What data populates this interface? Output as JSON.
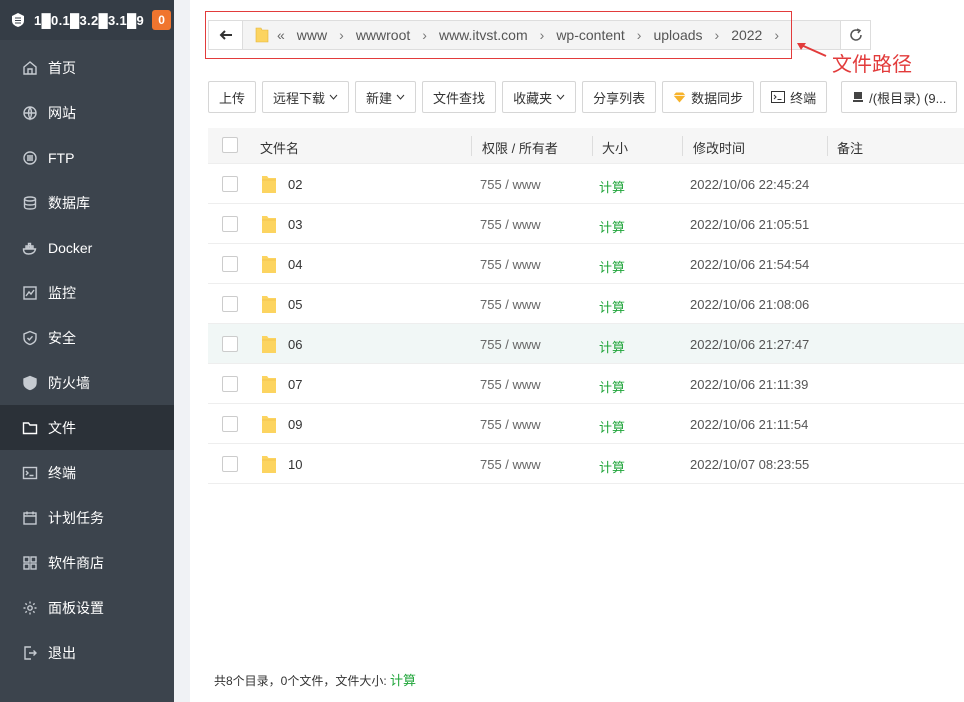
{
  "sidebar": {
    "server_ip": "1█0.1█3.2█3.1█9",
    "badge": "0",
    "items": [
      {
        "label": "首页",
        "icon": "home-icon"
      },
      {
        "label": "网站",
        "icon": "globe-icon"
      },
      {
        "label": "FTP",
        "icon": "ftp-icon"
      },
      {
        "label": "数据库",
        "icon": "database-icon"
      },
      {
        "label": "Docker",
        "icon": "docker-icon"
      },
      {
        "label": "监控",
        "icon": "monitor-icon"
      },
      {
        "label": "安全",
        "icon": "shield-icon"
      },
      {
        "label": "防火墙",
        "icon": "firewall-icon"
      },
      {
        "label": "文件",
        "icon": "folder-icon"
      },
      {
        "label": "终端",
        "icon": "terminal-icon"
      },
      {
        "label": "计划任务",
        "icon": "calendar-icon"
      },
      {
        "label": "软件商店",
        "icon": "grid-icon"
      },
      {
        "label": "面板设置",
        "icon": "gear-icon"
      },
      {
        "label": "退出",
        "icon": "logout-icon"
      }
    ],
    "active_index": 8
  },
  "path": {
    "crumbs": [
      "www",
      "wwwroot",
      "www.itvst.com",
      "wp-content",
      "uploads",
      "2022"
    ],
    "annotation": "文件路径"
  },
  "toolbar": {
    "upload": "上传",
    "remote_download": "远程下载",
    "new": "新建",
    "find": "文件查找",
    "favorites": "收藏夹",
    "share_list": "分享列表",
    "sync": "数据同步",
    "terminal": "终端",
    "disk": "/(根目录) (9..."
  },
  "table": {
    "headers": {
      "name": "文件名",
      "perm": "权限 / 所有者",
      "size": "大小",
      "mtime": "修改时间",
      "note": "备注"
    },
    "rows": [
      {
        "name": "02",
        "perm": "755 / www",
        "size": "计算",
        "mtime": "2022/10/06 22:45:24"
      },
      {
        "name": "03",
        "perm": "755 / www",
        "size": "计算",
        "mtime": "2022/10/06 21:05:51"
      },
      {
        "name": "04",
        "perm": "755 / www",
        "size": "计算",
        "mtime": "2022/10/06 21:54:54"
      },
      {
        "name": "05",
        "perm": "755 / www",
        "size": "计算",
        "mtime": "2022/10/06 21:08:06"
      },
      {
        "name": "06",
        "perm": "755 / www",
        "size": "计算",
        "mtime": "2022/10/06 21:27:47"
      },
      {
        "name": "07",
        "perm": "755 / www",
        "size": "计算",
        "mtime": "2022/10/06 21:11:39"
      },
      {
        "name": "09",
        "perm": "755 / www",
        "size": "计算",
        "mtime": "2022/10/06 21:11:54"
      },
      {
        "name": "10",
        "perm": "755 / www",
        "size": "计算",
        "mtime": "2022/10/07 08:23:55"
      }
    ],
    "hover_index": 4
  },
  "footer": {
    "summary": "共8个目录，0个文件，文件大小:",
    "calc": "计算"
  },
  "colors": {
    "sidebar_bg": "#3c444d",
    "accent_green": "#20a53a",
    "badge_orange": "#f0752f",
    "annotation_red": "#e23b3b"
  }
}
